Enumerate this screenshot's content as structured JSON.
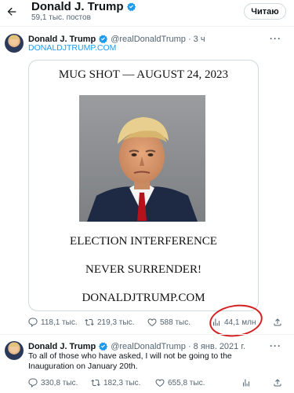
{
  "header": {
    "profile_name": "Donald J. Trump",
    "post_count": "59,1 тыс. постов",
    "follow_label": "Читаю"
  },
  "tweet1": {
    "name": "Donald J. Trump",
    "handle": "@realDonaldTrump",
    "time": "· 3 ч",
    "link": "DONALDJTRUMP.COM",
    "card": {
      "title": "MUG SHOT — AUGUST 24, 2023",
      "line1": "ELECTION INTERFERENCE",
      "line2": "NEVER SURRENDER!",
      "line3": "DONALDJTRUMP.COM"
    },
    "stats": {
      "replies": "118,1 тыс.",
      "reposts": "219,3 тыс.",
      "likes": "588 тыс.",
      "views": "44,1 млн"
    }
  },
  "tweet2": {
    "name": "Donald J. Trump",
    "handle": "@realDonaldTrump",
    "time": "· 8 янв. 2021 г.",
    "text": "To all of those who have asked, I will not be going to the Inauguration on January 20th.",
    "stats": {
      "replies": "330,8 тыс.",
      "reposts": "182,3 тыс.",
      "likes": "655,8 тыс."
    }
  },
  "colors": {
    "accent": "#1d9bf0",
    "muted": "#536471",
    "highlight": "#d42020"
  },
  "icons": [
    "back-arrow-icon",
    "verified-badge-icon",
    "more-icon",
    "reply-icon",
    "repost-icon",
    "like-icon",
    "views-icon",
    "share-icon"
  ]
}
